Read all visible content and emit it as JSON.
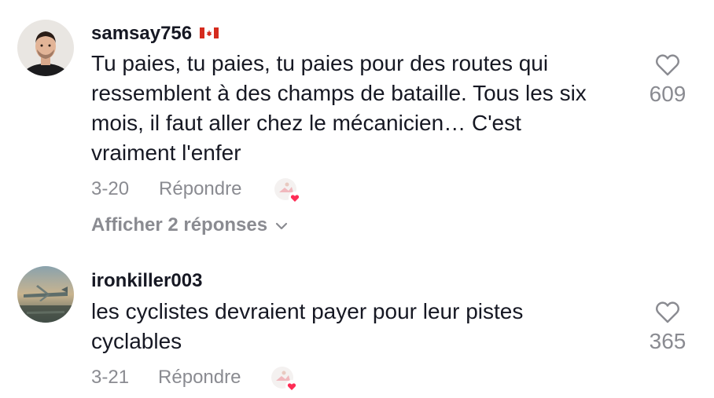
{
  "comments": [
    {
      "username": "samsay756",
      "flag": "canada-flag-icon",
      "avatar": "avatar-young-man",
      "text_lines": [
        "Tu paies, tu paies, tu paies pour des routes qui",
        "ressemblent à des champs de bataille. Tous les six",
        "mois, il faut aller chez le mécanicien… C'est",
        "vraiment l'enfer"
      ],
      "date": "3-20",
      "reply_label": "Répondre",
      "likes": "609",
      "view_replies": "Afficher 2 réponses"
    },
    {
      "username": "ironkiller003",
      "avatar": "avatar-airplane",
      "text_lines": [
        "les cyclistes devraient payer pour leur pistes",
        "cyclables"
      ],
      "date": "3-21",
      "reply_label": "Répondre",
      "likes": "365"
    }
  ],
  "colors": {
    "text": "#161823",
    "muted": "#8a8b91",
    "heart_badge": "#fe2c55",
    "flag_red": "#d52b1e"
  }
}
